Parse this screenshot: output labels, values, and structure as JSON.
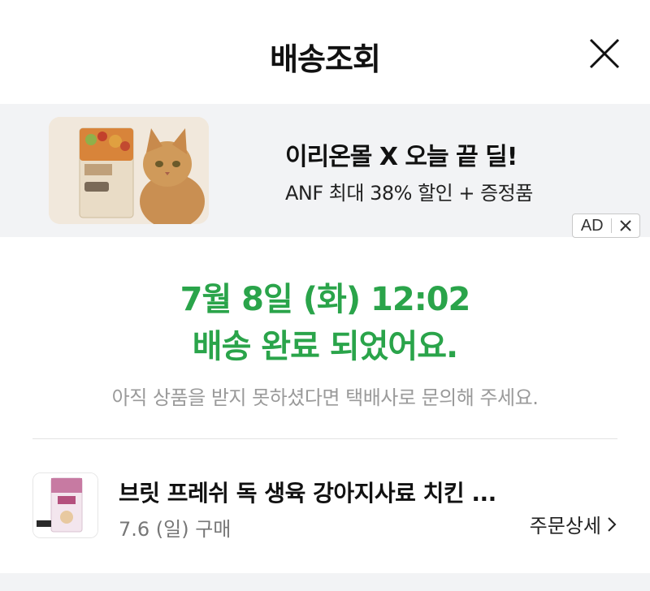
{
  "header": {
    "title": "배송조회",
    "close_icon": "close-icon"
  },
  "ad": {
    "headline": "이리온몰 X 오늘 끝 딜!",
    "sub": "ANF 최대 38% 할인 + 증정품",
    "badge_label": "AD",
    "badge_close_icon": "close-icon"
  },
  "status": {
    "when": "7월 8일 (화) 12:02",
    "done": "배송 완료 되었어요.",
    "note": "아직 상품을 받지 못하셨다면 택배사로 문의해 주세요."
  },
  "order": {
    "product_name": "브릿 프레쉬 독 생육 강아지사료 치킨 ...",
    "purchase_date": "7.6 (일) 구매",
    "detail_label": "주문상세",
    "detail_icon": "chevron-right-icon"
  },
  "colors": {
    "accent_green": "#2aa44a",
    "ad_bg": "#f2f3f5",
    "muted_text": "#9a9a9a"
  }
}
